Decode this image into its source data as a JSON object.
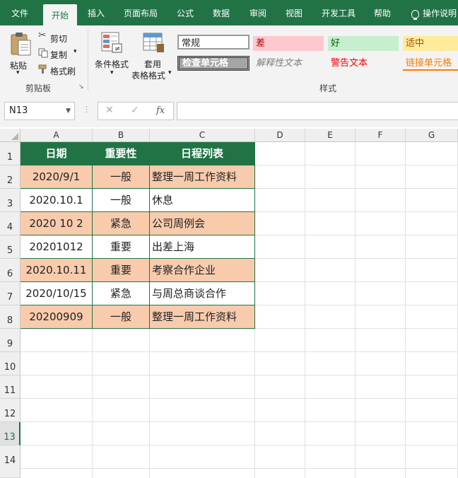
{
  "tabs": [
    "文件",
    "开始",
    "插入",
    "页面布局",
    "公式",
    "数据",
    "审阅",
    "视图",
    "开发工具",
    "帮助",
    "操作说明"
  ],
  "active_tab": "开始",
  "clipboard": {
    "paste": "粘贴",
    "cut": "剪切",
    "copy": "复制",
    "format_painter": "格式刷",
    "group_label": "剪贴板"
  },
  "styles_group": {
    "conditional_format": "条件格式",
    "table_format_line1": "套用",
    "table_format_line2": "表格格式",
    "normal": "常规",
    "bad": "差",
    "good": "好",
    "neutral": "适中",
    "check_cell": "检查单元格",
    "explanatory": "解释性文本",
    "warning": "警告文本",
    "linked_cell": "链接单元格",
    "group_label": "样式"
  },
  "formula_bar": {
    "name_box": "N13",
    "cancel": "✕",
    "enter": "✓",
    "fx": "fx",
    "value": ""
  },
  "columns": [
    "A",
    "B",
    "C",
    "D",
    "E",
    "F",
    "G"
  ],
  "rows": [
    "1",
    "2",
    "3",
    "4",
    "5",
    "6",
    "7",
    "8",
    "9",
    "10",
    "11",
    "12",
    "13",
    "14"
  ],
  "selected_row": "13",
  "table": {
    "headers": [
      "日期",
      "重要性",
      "日程列表"
    ],
    "data": [
      [
        "2020/9/1",
        "一般",
        "整理一周工作资料"
      ],
      [
        "2020.10.1",
        "一般",
        "休息"
      ],
      [
        "2020 10 2",
        "紧急",
        "公司周例会"
      ],
      [
        "20201012",
        "重要",
        "出差上海"
      ],
      [
        "2020.10.11",
        "重要",
        "考察合作企业"
      ],
      [
        "2020/10/15",
        "紧急",
        "与周总商谈合作"
      ],
      [
        "20200909",
        "一般",
        "整理一周工作资料"
      ]
    ]
  },
  "colors": {
    "accent": "#217346",
    "band": "#f8cbad",
    "bad_bg": "#ffc7ce",
    "bad_text": "#9c0006",
    "good_bg": "#c6efce",
    "good_text": "#006100",
    "neutral_bg": "#ffeb9c",
    "neutral_text": "#9c5700",
    "warning_text": "#ff0000",
    "linked_text": "#fa7d00",
    "check_bg": "#a5a5a5"
  }
}
